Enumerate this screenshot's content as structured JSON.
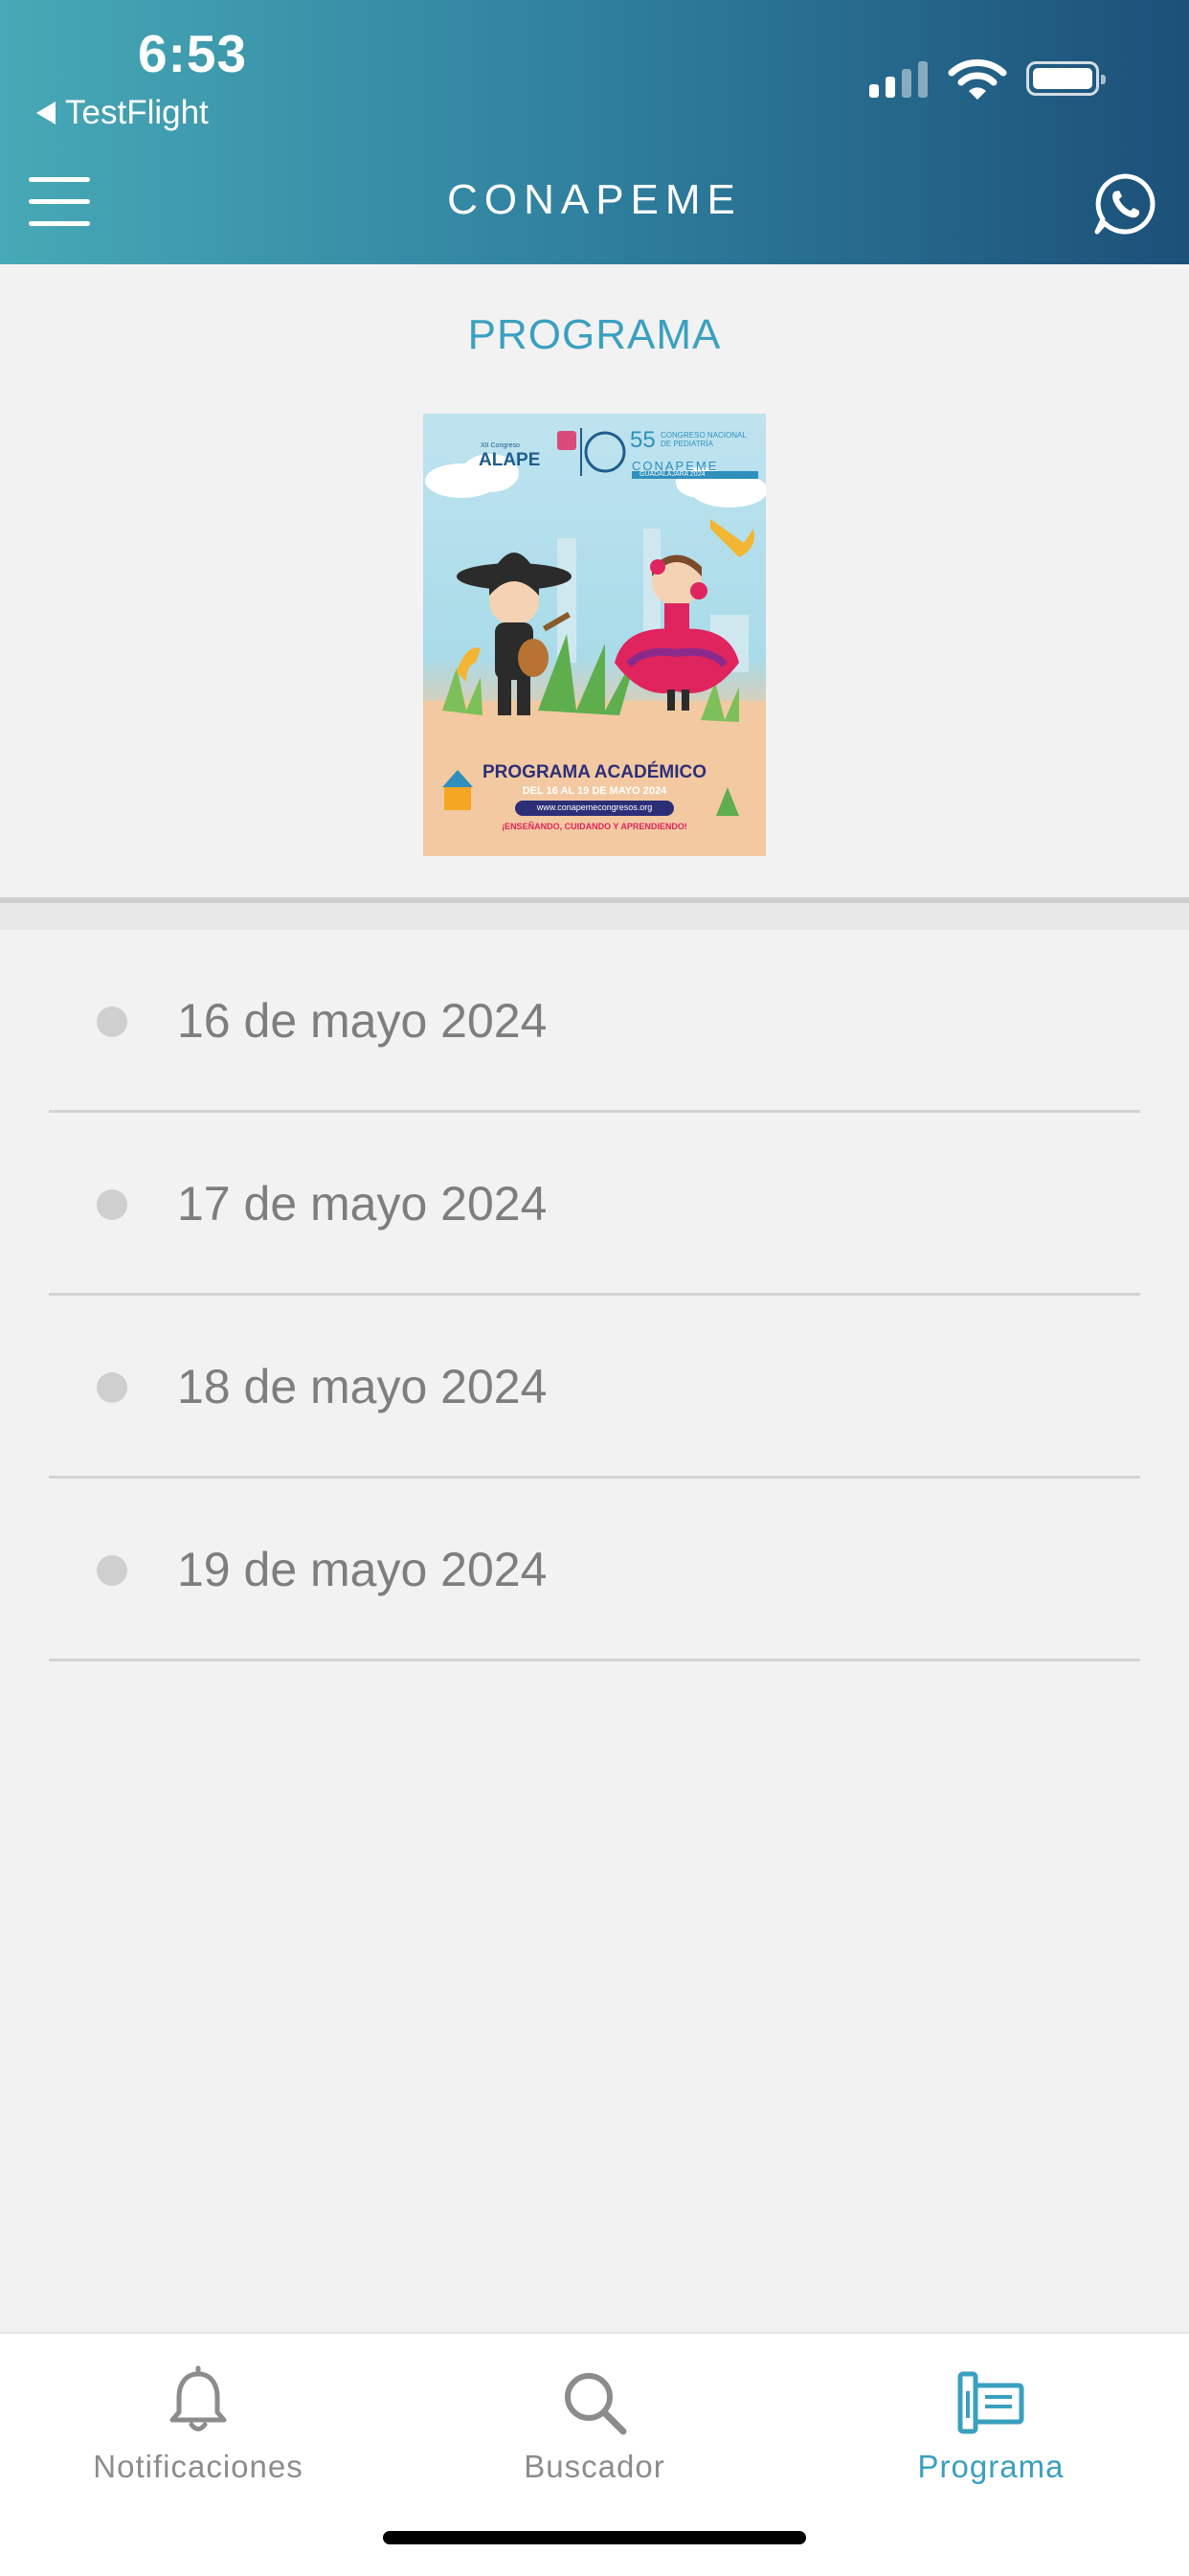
{
  "status_bar": {
    "time": "6:53",
    "back_app": "TestFlight"
  },
  "header": {
    "title": "CONAPEME"
  },
  "main": {
    "section_title": "PROGRAMA",
    "poster": {
      "org": "ALAPE",
      "edition": "55",
      "congress_text": "CONGRESO NACIONAL DE PEDIATRÍA",
      "brand": "CONAPEME",
      "city": "GUADALAJARA 2024",
      "headline": "PROGRAMA ACADÉMICO",
      "dates": "DEL 16 AL 19 DE MAYO 2024",
      "url": "www.conapemecongresos.org",
      "slogan": "¡ENSEÑANDO, CUIDANDO Y APRENDIENDO!"
    },
    "days": [
      {
        "label": "16 de mayo 2024"
      },
      {
        "label": "17 de mayo 2024"
      },
      {
        "label": "18 de mayo 2024"
      },
      {
        "label": "19 de mayo 2024"
      }
    ]
  },
  "tabs": [
    {
      "label": "Notificaciones",
      "icon": "bell-icon"
    },
    {
      "label": "Buscador",
      "icon": "search-icon"
    },
    {
      "label": "Programa",
      "icon": "program-icon",
      "active": true
    }
  ],
  "colors": {
    "accent": "#3aa0bf",
    "header_start": "#47a9b6",
    "header_end": "#1c5079"
  }
}
